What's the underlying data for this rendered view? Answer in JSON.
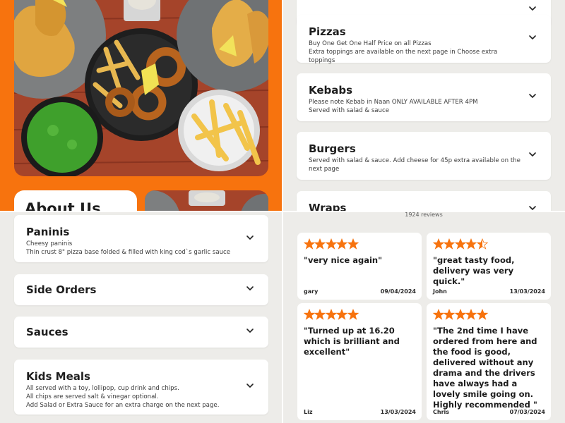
{
  "about": {
    "title": "About Us"
  },
  "accent_color": "#f7730e",
  "star_color": "#f7730e",
  "menu_top": [
    {
      "title": "",
      "desc": []
    },
    {
      "title": "Pizzas",
      "desc": [
        "Buy One Get One Half Price on all Pizzas",
        "Extra toppings are available on the next page in Choose extra toppings"
      ]
    },
    {
      "title": "Kebabs",
      "desc": [
        "Please note Kebab in Naan ONLY AVAILABLE AFTER 4PM",
        "Served with salad & sauce"
      ]
    },
    {
      "title": "Burgers",
      "desc": [
        "Served with salad & sauce. Add cheese for 45p extra available on the next page"
      ]
    },
    {
      "title": "Wraps",
      "desc": []
    }
  ],
  "menu_bottom": [
    {
      "title": "Paninis",
      "desc": [
        "Cheesy paninis",
        "Thin crust 8\" pizza base folded & filled with king cod`s garlic sauce"
      ]
    },
    {
      "title": "Side Orders",
      "desc": []
    },
    {
      "title": "Sauces",
      "desc": []
    },
    {
      "title": "Kids Meals",
      "desc": [
        "All served with a toy, lollipop, cup drink and chips.",
        "All chips are served salt & vinegar optional.",
        "Add Salad or Extra Sauce for an extra charge on the next page."
      ]
    }
  ],
  "reviews": {
    "count_label": "1924 reviews",
    "items": [
      {
        "rating": 5,
        "text": "\"very nice again\"",
        "author": "gary",
        "date": "09/04/2024"
      },
      {
        "rating": 4.5,
        "text": "\"great tasty food, delivery was very quick.\"",
        "author": "John",
        "date": "13/03/2024"
      },
      {
        "rating": 5,
        "text": "\"Turned up at 16.20 which is brilliant and excellent\"",
        "author": "Liz",
        "date": "13/03/2024"
      },
      {
        "rating": 5,
        "text": "\"The 2nd time I have ordered from here and the food is good, delivered without any drama and the drivers have always had a lovely smile going on. Highly recommended    \"",
        "author": "Chris",
        "date": "07/03/2024"
      }
    ]
  }
}
